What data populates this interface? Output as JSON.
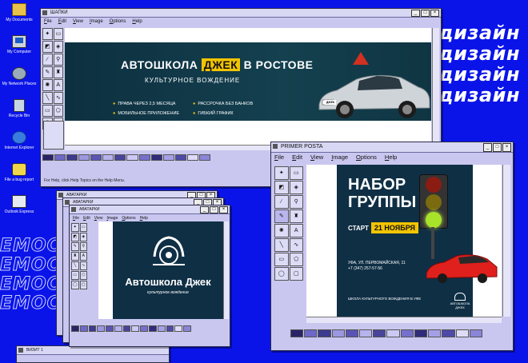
{
  "desktop_icons": [
    {
      "label": "My Documents",
      "icon": "folder-icon"
    },
    {
      "label": "My Computer",
      "icon": "computer-icon"
    },
    {
      "label": "My Network Places",
      "icon": "network-icon"
    },
    {
      "label": "Recycle Bin",
      "icon": "recycle-bin-icon"
    },
    {
      "label": "Internet Explorer",
      "icon": "ie-icon"
    },
    {
      "label": "File a bug report",
      "icon": "bug-icon"
    },
    {
      "label": "Outlook Express",
      "icon": "mail-icon"
    }
  ],
  "decor": {
    "dizain": [
      "дизайн",
      "дизайн",
      "дизайн",
      "дизайн"
    ],
    "emoc": [
      "EMOC",
      "EMOC",
      "EMOC",
      "EMOC"
    ]
  },
  "menu": [
    "File",
    "Edit",
    "View",
    "Image",
    "Options",
    "Help"
  ],
  "window1": {
    "title": "ШАПКИ",
    "status": "For Help, click Help Topics on the Help Menu.",
    "banner": {
      "title_pre": "АВТОШКОЛА ",
      "title_hl": "ДЖЕК",
      "title_post": " В РОСТОВЕ",
      "subtitle": "КУЛЬТУРНОЕ ВОЖДЕНИЕ",
      "features": [
        "ПРАВА ЧЕРЕЗ 2,5 МЕСЯЦА",
        "РАССРОЧКА БЕЗ БАНКОВ",
        "МОБИЛЬНОЕ ПРИЛОЖЕНИЕ",
        "ГИБКИЙ ГРАФИК"
      ],
      "plate": "ДЖЕК"
    }
  },
  "window2": {
    "title": "PRIMER POSTA",
    "banner": {
      "headline_1": "НАБОР",
      "headline_2": "ГРУППЫ",
      "start_label": "СТАРТ",
      "start_date": "21 НОЯБРЯ",
      "address_1": "УФА, УЛ. ПЕРВОМАЙСКАЯ, 11",
      "address_2": "+7 (347) 257-57-56",
      "school": "ШКОЛА КУЛЬТУРНОГО ВОЖДЕНИЯ В УФЕ",
      "logo": "АВТОШКОЛА ДЖЕК"
    }
  },
  "window3": {
    "title": "АВАТАРКИ",
    "banner": {
      "title": "Автошкола Джек",
      "subtitle": "культурное вождение"
    }
  },
  "window4": {
    "title": "ВИЗИТ 1"
  },
  "colors": {
    "desktop": "#0a14e8",
    "window": "#c9c7ef",
    "accent_yellow": "#f2c400",
    "banner_dark": "#0f2f45"
  }
}
